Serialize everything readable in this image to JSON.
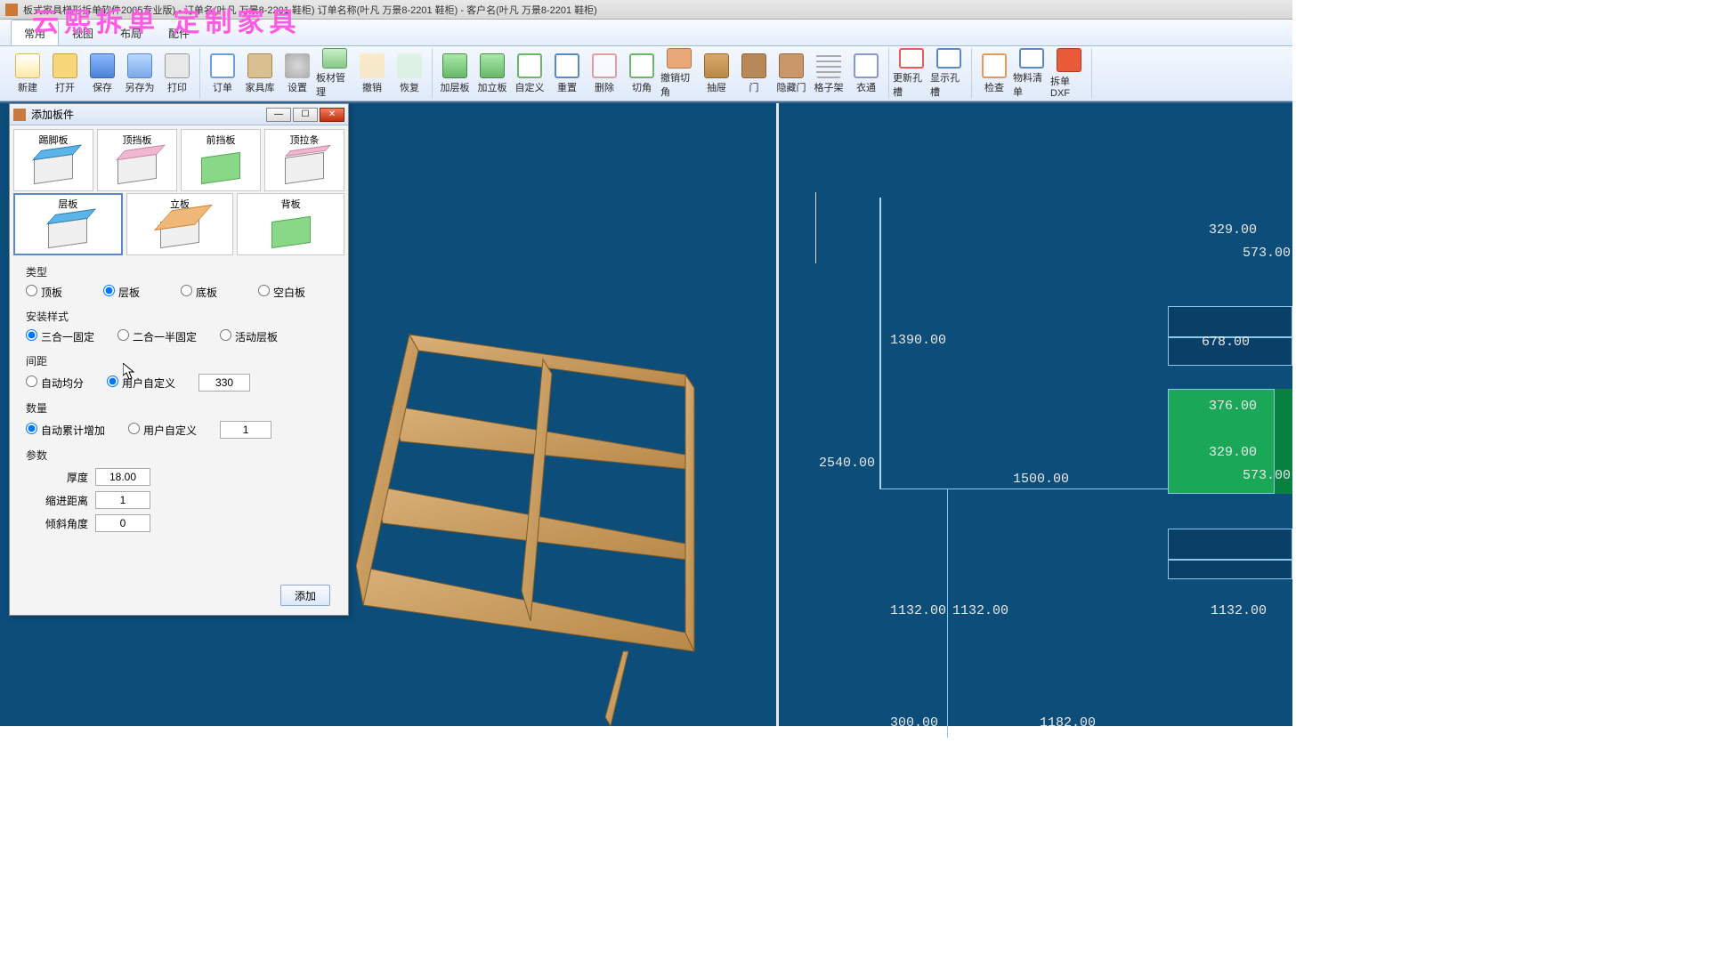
{
  "title_text": "板式家具梯形拆单软件2005专业版) - 订单名(叶凡 万景8-2201 鞋柜)   订单名称(叶凡 万景8-2201 鞋柜) - 客户名(叶凡 万景8-2201 鞋柜)",
  "watermark": "云熙拆单   定制家具",
  "menu": {
    "tabs": [
      "常用",
      "视图",
      "布局",
      "配件"
    ]
  },
  "toolbar": {
    "g1": [
      "新建",
      "打开",
      "保存",
      "另存为",
      "打印"
    ],
    "g2": [
      "订单",
      "家具库",
      "设置",
      "板材管理",
      "撤销",
      "恢复"
    ],
    "g3": [
      "加层板",
      "加立板",
      "自定义",
      "重置",
      "删除",
      "切角",
      "撤销切角",
      "抽屉",
      "门",
      "隐藏门",
      "格子架",
      "衣通"
    ],
    "g4": [
      "更新孔槽",
      "显示孔槽"
    ],
    "g5": [
      "检查",
      "物料清单",
      "拆单DXF"
    ]
  },
  "dialog": {
    "title": "添加板件",
    "cards_r1": [
      "踢脚板",
      "顶挡板",
      "前挡板",
      "顶拉条"
    ],
    "cards_r2": [
      "层板",
      "立板",
      "背板"
    ],
    "sec_type": "类型",
    "type_opts": [
      "顶板",
      "层板",
      "底板",
      "空白板"
    ],
    "sec_install": "安装样式",
    "install_opts": [
      "三合一固定",
      "二合一半固定",
      "活动层板"
    ],
    "sec_gap": "间距",
    "gap_opts": [
      "自动均分",
      "用户自定义"
    ],
    "gap_value": "330",
    "sec_count": "数量",
    "count_opts": [
      "自动累计增加",
      "用户自定义"
    ],
    "count_value": "1",
    "sec_param": "参数",
    "param_thickness_lbl": "厚度",
    "param_thickness": "18.00",
    "param_indent_lbl": "缩进距离",
    "param_indent": "1",
    "param_angle_lbl": "倾斜角度",
    "param_angle": "0",
    "add_btn": "添加"
  },
  "dims": {
    "d1": "1390.00",
    "d2": "2540.00",
    "d3": "1132.00",
    "d4": "1132.00",
    "d5": "300.00",
    "d6": "1182.00",
    "d7": "1500.00",
    "d8": "329.00",
    "d9": "573.00",
    "d10": "678.00",
    "d11": "376.00",
    "d12": "329.00",
    "d13": "573.00",
    "d14": "1132.00"
  }
}
